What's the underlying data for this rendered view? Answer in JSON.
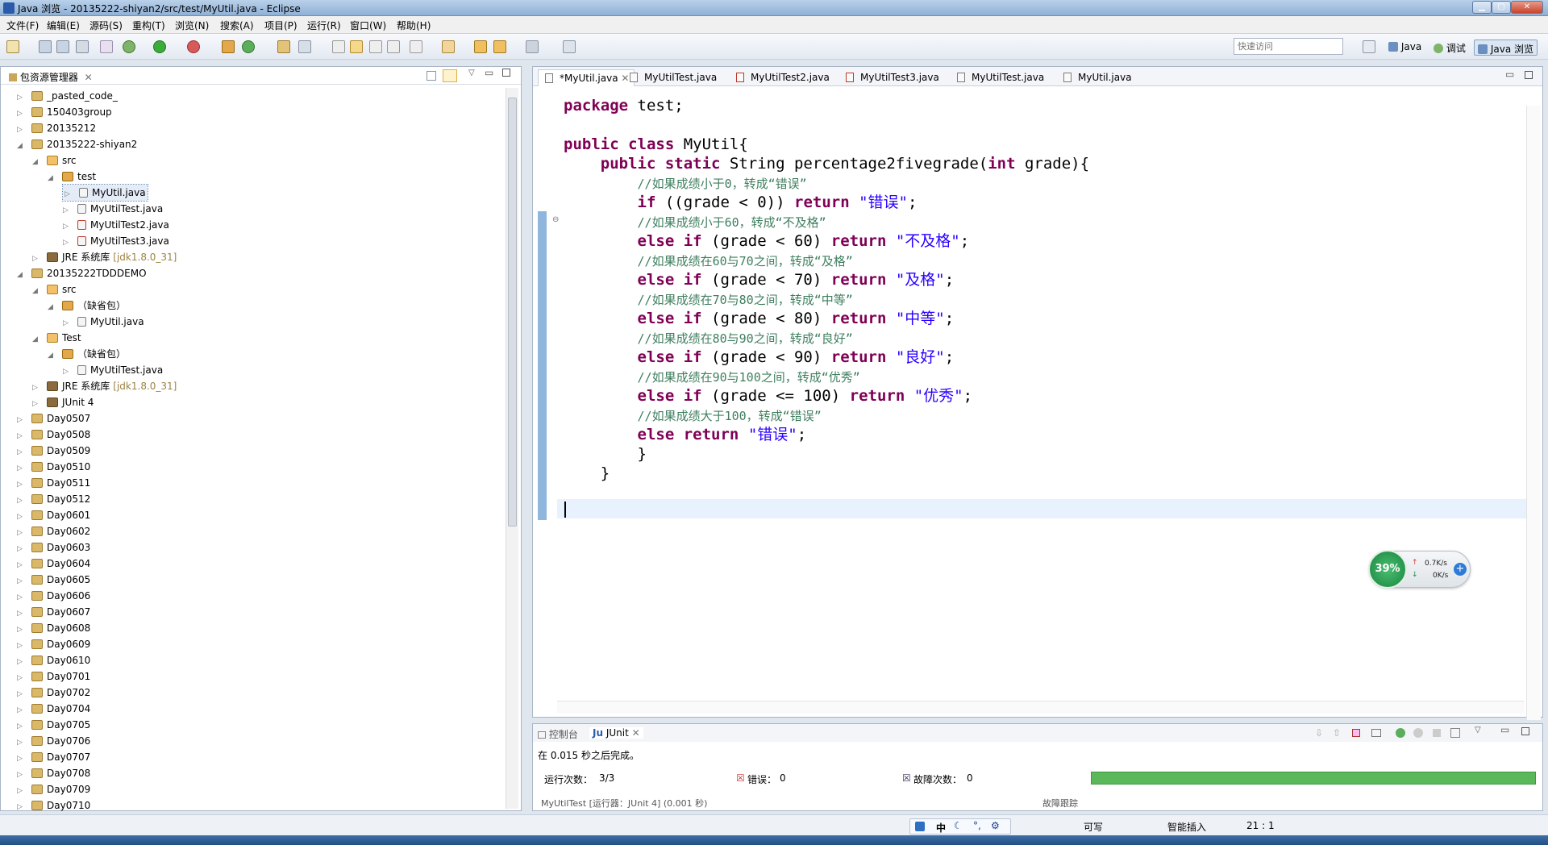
{
  "window": {
    "title": "Java 浏览  - 20135222-shiyan2/src/test/MyUtil.java  - Eclipse"
  },
  "menu": [
    "文件(F)",
    "编辑(E)",
    "源码(S)",
    "重构(T)",
    "浏览(N)",
    "搜索(A)",
    "项目(P)",
    "运行(R)",
    "窗口(W)",
    "帮助(H)"
  ],
  "toolbar": {
    "quick_access_placeholder": "快速访问",
    "perspectives": [
      "Java",
      "调试",
      "Java 浏览"
    ]
  },
  "package_explorer": {
    "title": "包资源管理器",
    "tree": [
      {
        "label": "_pasted_code_",
        "indent": 0,
        "arrow": "▷",
        "icon": "proj"
      },
      {
        "label": "150403group",
        "indent": 0,
        "arrow": "▷",
        "icon": "proj"
      },
      {
        "label": "20135212",
        "indent": 0,
        "arrow": "▷",
        "icon": "proj"
      },
      {
        "label": "20135222-shiyan2",
        "indent": 0,
        "arrow": "◢",
        "icon": "proj"
      },
      {
        "label": "src",
        "indent": 1,
        "arrow": "◢",
        "icon": "pkgf"
      },
      {
        "label": "test",
        "indent": 2,
        "arrow": "◢",
        "icon": "pkg"
      },
      {
        "label": "MyUtil.java",
        "indent": 3,
        "arrow": "▷",
        "icon": "jfile",
        "selected": true
      },
      {
        "label": "MyUtilTest.java",
        "indent": 3,
        "arrow": "▷",
        "icon": "jfile"
      },
      {
        "label": "MyUtilTest2.java",
        "indent": 3,
        "arrow": "▷",
        "icon": "jfile err"
      },
      {
        "label": "MyUtilTest3.java",
        "indent": 3,
        "arrow": "▷",
        "icon": "jfile err"
      },
      {
        "label": "JRE 系统库",
        "deco": "[jdk1.8.0_31]",
        "indent": 1,
        "arrow": "▷",
        "icon": "lib"
      },
      {
        "label": "20135222TDDDEMO",
        "indent": 0,
        "arrow": "◢",
        "icon": "proj"
      },
      {
        "label": "src",
        "indent": 1,
        "arrow": "◢",
        "icon": "pkgf"
      },
      {
        "label": "（缺省包）",
        "indent": 2,
        "arrow": "◢",
        "icon": "pkg"
      },
      {
        "label": "MyUtil.java",
        "indent": 3,
        "arrow": "▷",
        "icon": "jfile"
      },
      {
        "label": "Test",
        "indent": 1,
        "arrow": "◢",
        "icon": "pkgf"
      },
      {
        "label": "（缺省包）",
        "indent": 2,
        "arrow": "◢",
        "icon": "pkg"
      },
      {
        "label": "MyUtilTest.java",
        "indent": 3,
        "arrow": "▷",
        "icon": "jfile"
      },
      {
        "label": "JRE 系统库",
        "deco": "[jdk1.8.0_31]",
        "indent": 1,
        "arrow": "▷",
        "icon": "lib"
      },
      {
        "label": "JUnit 4",
        "indent": 1,
        "arrow": "▷",
        "icon": "lib"
      },
      {
        "label": "Day0507",
        "indent": 0,
        "arrow": "▷",
        "icon": "proj"
      },
      {
        "label": "Day0508",
        "indent": 0,
        "arrow": "▷",
        "icon": "proj"
      },
      {
        "label": "Day0509",
        "indent": 0,
        "arrow": "▷",
        "icon": "proj"
      },
      {
        "label": "Day0510",
        "indent": 0,
        "arrow": "▷",
        "icon": "proj"
      },
      {
        "label": "Day0511",
        "indent": 0,
        "arrow": "▷",
        "icon": "proj"
      },
      {
        "label": "Day0512",
        "indent": 0,
        "arrow": "▷",
        "icon": "proj"
      },
      {
        "label": "Day0601",
        "indent": 0,
        "arrow": "▷",
        "icon": "proj"
      },
      {
        "label": "Day0602",
        "indent": 0,
        "arrow": "▷",
        "icon": "proj"
      },
      {
        "label": "Day0603",
        "indent": 0,
        "arrow": "▷",
        "icon": "proj"
      },
      {
        "label": "Day0604",
        "indent": 0,
        "arrow": "▷",
        "icon": "proj"
      },
      {
        "label": "Day0605",
        "indent": 0,
        "arrow": "▷",
        "icon": "proj"
      },
      {
        "label": "Day0606",
        "indent": 0,
        "arrow": "▷",
        "icon": "proj"
      },
      {
        "label": "Day0607",
        "indent": 0,
        "arrow": "▷",
        "icon": "proj"
      },
      {
        "label": "Day0608",
        "indent": 0,
        "arrow": "▷",
        "icon": "proj"
      },
      {
        "label": "Day0609",
        "indent": 0,
        "arrow": "▷",
        "icon": "proj"
      },
      {
        "label": "Day0610",
        "indent": 0,
        "arrow": "▷",
        "icon": "proj"
      },
      {
        "label": "Day0701",
        "indent": 0,
        "arrow": "▷",
        "icon": "proj"
      },
      {
        "label": "Day0702",
        "indent": 0,
        "arrow": "▷",
        "icon": "proj"
      },
      {
        "label": "Day0704",
        "indent": 0,
        "arrow": "▷",
        "icon": "proj"
      },
      {
        "label": "Day0705",
        "indent": 0,
        "arrow": "▷",
        "icon": "proj"
      },
      {
        "label": "Day0706",
        "indent": 0,
        "arrow": "▷",
        "icon": "proj"
      },
      {
        "label": "Day0707",
        "indent": 0,
        "arrow": "▷",
        "icon": "proj"
      },
      {
        "label": "Day0708",
        "indent": 0,
        "arrow": "▷",
        "icon": "proj"
      },
      {
        "label": "Day0709",
        "indent": 0,
        "arrow": "▷",
        "icon": "proj"
      },
      {
        "label": "Day0710",
        "indent": 0,
        "arrow": "▷",
        "icon": "proj"
      }
    ]
  },
  "editor": {
    "tabs": [
      "*MyUtil.java",
      "MyUtilTest.java",
      "MyUtilTest2.java",
      "MyUtilTest3.java",
      "MyUtilTest.java",
      "MyUtil.java"
    ],
    "code": [
      [
        [
          "kw",
          "package"
        ],
        [
          "n",
          " test;"
        ]
      ],
      [],
      [
        [
          "kw",
          "public class"
        ],
        [
          "n",
          " MyUtil{"
        ]
      ],
      [
        [
          "n",
          "    "
        ],
        [
          "kw",
          "public static"
        ],
        [
          "n",
          " String percentage2fivegrade("
        ],
        [
          "kw",
          "int"
        ],
        [
          "n",
          " grade){"
        ]
      ],
      [
        [
          "n",
          "        "
        ],
        [
          "cm",
          "//如果成绩小于0，转成“错误”"
        ]
      ],
      [
        [
          "n",
          "        "
        ],
        [
          "kw",
          "if"
        ],
        [
          "n",
          " ((grade < 0)) "
        ],
        [
          "kw",
          "return"
        ],
        [
          "n",
          " "
        ],
        [
          "str",
          "\"错误\""
        ],
        [
          "n",
          ";"
        ]
      ],
      [
        [
          "n",
          "        "
        ],
        [
          "cm",
          "//如果成绩小于60，转成“不及格”"
        ]
      ],
      [
        [
          "n",
          "        "
        ],
        [
          "kw",
          "else if"
        ],
        [
          "n",
          " (grade < 60) "
        ],
        [
          "kw",
          "return"
        ],
        [
          "n",
          " "
        ],
        [
          "str",
          "\"不及格\""
        ],
        [
          "n",
          ";"
        ]
      ],
      [
        [
          "n",
          "        "
        ],
        [
          "cm",
          "//如果成绩在60与70之间，转成“及格”"
        ]
      ],
      [
        [
          "n",
          "        "
        ],
        [
          "kw",
          "else if"
        ],
        [
          "n",
          " (grade < 70) "
        ],
        [
          "kw",
          "return"
        ],
        [
          "n",
          " "
        ],
        [
          "str",
          "\"及格\""
        ],
        [
          "n",
          ";"
        ]
      ],
      [
        [
          "n",
          "        "
        ],
        [
          "cm",
          "//如果成绩在70与80之间，转成“中等”"
        ]
      ],
      [
        [
          "n",
          "        "
        ],
        [
          "kw",
          "else if"
        ],
        [
          "n",
          " (grade < 80) "
        ],
        [
          "kw",
          "return"
        ],
        [
          "n",
          " "
        ],
        [
          "str",
          "\"中等\""
        ],
        [
          "n",
          ";"
        ]
      ],
      [
        [
          "n",
          "        "
        ],
        [
          "cm",
          "//如果成绩在80与90之间，转成“良好”"
        ]
      ],
      [
        [
          "n",
          "        "
        ],
        [
          "kw",
          "else if"
        ],
        [
          "n",
          " (grade < 90) "
        ],
        [
          "kw",
          "return"
        ],
        [
          "n",
          " "
        ],
        [
          "str",
          "\"良好\""
        ],
        [
          "n",
          ";"
        ]
      ],
      [
        [
          "n",
          "        "
        ],
        [
          "cm",
          "//如果成绩在90与100之间，转成“优秀”"
        ]
      ],
      [
        [
          "n",
          "        "
        ],
        [
          "kw",
          "else if"
        ],
        [
          "n",
          " (grade <= 100) "
        ],
        [
          "kw",
          "return"
        ],
        [
          "n",
          " "
        ],
        [
          "str",
          "\"优秀\""
        ],
        [
          "n",
          ";"
        ]
      ],
      [
        [
          "n",
          "        "
        ],
        [
          "cm",
          "//如果成绩大于100，转成“错误”"
        ]
      ],
      [
        [
          "n",
          "        "
        ],
        [
          "kw",
          "else return"
        ],
        [
          "n",
          " "
        ],
        [
          "str",
          "\"错误\""
        ],
        [
          "n",
          ";"
        ]
      ],
      [
        [
          "n",
          "        }"
        ]
      ],
      [
        [
          "n",
          "    }"
        ]
      ],
      []
    ]
  },
  "speed_widget": {
    "cpu": "39%",
    "up": "0.7K/s",
    "down": "0K/s"
  },
  "junit": {
    "tabs": [
      "控制台",
      "JUnit"
    ],
    "status": "在 0.015 秒之后完成。",
    "runs_label": "运行次数：",
    "runs_value": "3/3",
    "errors_label": "错误：",
    "errors_value": "0",
    "failures_label": "故障次数：",
    "failures_value": "0",
    "bar_color": "#5ab85a",
    "row": "MyUtilTest [运行器：JUnit 4] (0.001 秒)",
    "trace_label": "故障跟踪"
  },
  "statusbar": {
    "ime": "中",
    "writable": "可写",
    "insert_mode": "智能插入",
    "position": "21 : 1"
  }
}
